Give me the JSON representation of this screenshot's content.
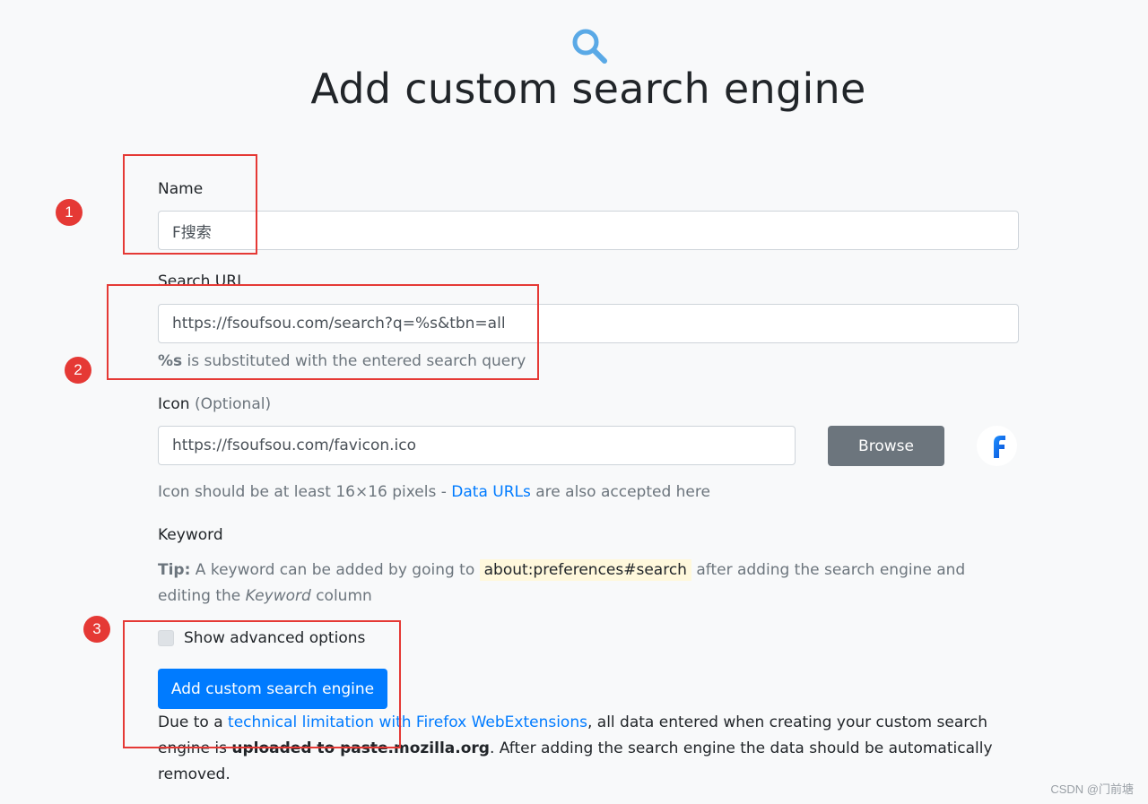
{
  "page": {
    "title": "Add custom search engine",
    "header_icon": "search-icon"
  },
  "form": {
    "name": {
      "label": "Name",
      "value": "F搜索"
    },
    "search_url": {
      "label": "Search URL",
      "value": "https://fsoufsou.com/search?q=%s&tbn=all",
      "help_bold": "%s",
      "help_text": " is substituted with the entered search query"
    },
    "icon": {
      "label": "Icon",
      "label_optional": "(Optional)",
      "value": "https://fsoufsou.com/favicon.ico",
      "browse_label": "Browse",
      "preview_letter": "F",
      "help_prefix": "Icon should be at least 16×16 pixels - ",
      "help_link": "Data URLs",
      "help_suffix": " are also accepted here"
    },
    "keyword": {
      "label": "Keyword",
      "tip_bold": "Tip:",
      "tip_text_1": " A keyword can be added by going to ",
      "tip_code": "about:preferences#search",
      "tip_text_2": " after adding the search engine and editing the ",
      "tip_italic": "Keyword",
      "tip_text_3": " column"
    },
    "advanced": {
      "label": "Show advanced options",
      "checked": false
    },
    "submit_label": "Add custom search engine",
    "note": {
      "prefix": "Due to a ",
      "link": "technical limitation with Firefox WebExtensions",
      "middle": ", all data entered when creating your custom search engine is ",
      "bold": "uploaded to paste.mozilla.org",
      "suffix": ". After adding the search engine the data should be automatically removed."
    }
  },
  "annotations": {
    "one": "1",
    "two": "2",
    "three": "3",
    "color": "#e53935"
  },
  "watermark": "CSDN @门前塘",
  "colors": {
    "background": "#f8f9fa",
    "primary": "#007bff",
    "secondary": "#6c757d",
    "link": "#007bff"
  }
}
